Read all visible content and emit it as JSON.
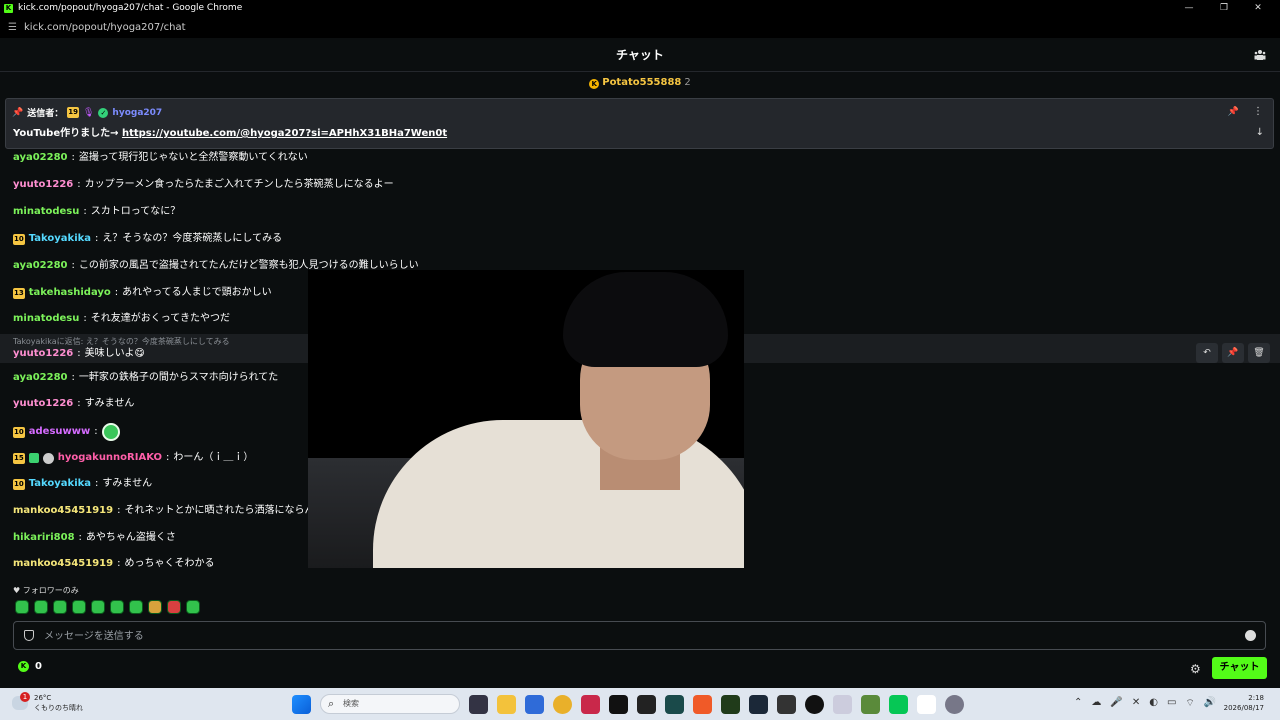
{
  "window": {
    "title": "kick.com/popout/hyoga207/chat - Google Chrome",
    "url": "kick.com/popout/hyoga207/chat",
    "controls": [
      "—",
      "❐",
      "✕"
    ]
  },
  "header": {
    "title": "チャット"
  },
  "gifter": {
    "name": "Potato555888",
    "count": "2"
  },
  "pinned": {
    "sent_by_label": "送信者：",
    "badge": "19",
    "username": "hyoga207",
    "text": "YouTube作りました→",
    "link": "https://youtube.com/@hyoga207?si=APHhX31BHa7Wen0t"
  },
  "messages": [
    {
      "user": "aya02280",
      "text": "盗撮って現行犯じゃないと全然警察動いてくれない",
      "color": "#7cf25a",
      "badge": ""
    },
    {
      "user": "yuuto1226",
      "text": "カップラーメン食ったらたまご入れてチンしたら茶碗蒸しになるよー",
      "color": "#ff8fd1",
      "badge": ""
    },
    {
      "user": "minatodesu",
      "text": "スカトロってなに？",
      "color": "#7cf25a",
      "badge": ""
    },
    {
      "user": "Takoyakika",
      "text": "え？そうなの？今度茶碗蒸しにしてみる",
      "color": "#55d9ff",
      "badge": "10"
    },
    {
      "user": "aya02280",
      "text": "この前家の風呂で盗撮されてたんだけど警察も犯人見つけるの難しいらしい",
      "color": "#7cf25a",
      "badge": ""
    },
    {
      "user": "takehashidayo",
      "text": "あれやってる人まじで頭おかしい",
      "color": "#7cf25a",
      "badge": "13"
    },
    {
      "user": "minatodesu",
      "text": "それ友達がおくってきたやつだ",
      "color": "#7cf25a",
      "badge": ""
    },
    {
      "user": "yuuto1226",
      "text": "美味しいよ😋",
      "color": "#ff8fd1",
      "badge": ""
    },
    {
      "user": "aya02280",
      "text": "一軒家の鉄格子の間からスマホ向けられてた",
      "color": "#7cf25a",
      "badge": ""
    },
    {
      "user": "yuuto1226",
      "text": "すみません",
      "color": "#ff8fd1",
      "badge": ""
    },
    {
      "user": "adesuwww",
      "text": "",
      "color": "#d56bff",
      "badge": "10"
    },
    {
      "user": "hyogakunnoRIAKO",
      "text": "わーん（ｉ＿ｉ）",
      "color": "#ff5fa9",
      "badge": "15"
    },
    {
      "user": "Takoyakika",
      "text": "すみません",
      "color": "#55d9ff",
      "badge": "10"
    },
    {
      "user": "mankoo45451919",
      "text": "それネットとかに晒されたら洒落にならんな",
      "color": "#f5e67a",
      "badge": ""
    },
    {
      "user": "hikariri808",
      "text": "あやちゃん盗撮くさ",
      "color": "#7cf25a",
      "badge": ""
    },
    {
      "user": "mankoo45451919",
      "text": "めっちゃくそわかる",
      "color": "#f5e67a",
      "badge": ""
    }
  ],
  "reply_ref": "Takoyakikaに返信: え？そうなの？今度茶碗蒸しにしてみる",
  "followers_only": "フォロワーのみ",
  "input": {
    "placeholder": "メッセージを送信する"
  },
  "points": "0",
  "chat_button": "チャット",
  "taskbar": {
    "weather_temp": "26°C",
    "weather_text": "くもりのち晴れ",
    "search": "検索",
    "time": "2:18",
    "date": "2026/08/17"
  },
  "colors": {
    "accent": "#53fc18",
    "panel": "#24272c",
    "background": "#0b0e0f"
  }
}
